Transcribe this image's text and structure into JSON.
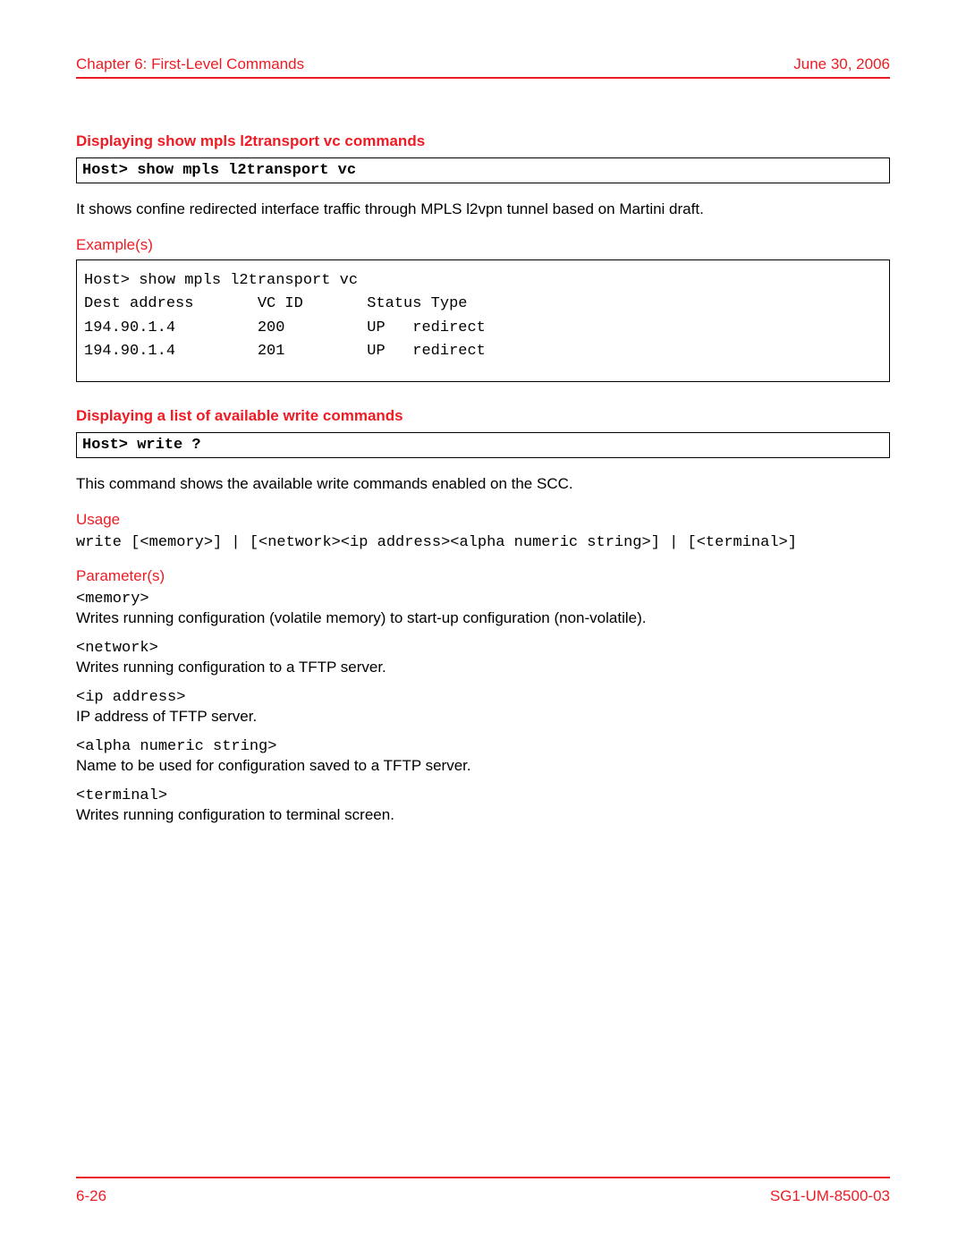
{
  "header": {
    "chapter": "Chapter 6: First-Level Commands",
    "date": "June 30, 2006"
  },
  "section1": {
    "title": "Displaying show mpls l2transport vc commands",
    "command": "Host> show mpls l2transport vc",
    "description": "It shows confine redirected interface traffic through MPLS l2vpn tunnel based on Martini draft.",
    "examples_label": "Example(s)",
    "example_text": "Host> show mpls l2transport vc\nDest address       VC ID       Status Type\n194.90.1.4         200         UP   redirect\n194.90.1.4         201         UP   redirect"
  },
  "section2": {
    "title": "Displaying a list of available write commands",
    "command": "Host> write ?",
    "description": "This command shows the available write commands enabled on the SCC.",
    "usage_label": "Usage",
    "usage_text": "write [<memory>] | [<network><ip address><alpha numeric string>] | [<terminal>]",
    "params_label": "Parameter(s)",
    "params": [
      {
        "name": "<memory>",
        "desc": "Writes running configuration (volatile memory) to start-up configuration (non-volatile)."
      },
      {
        "name": "<network>",
        "desc": "Writes running configuration to a TFTP server."
      },
      {
        "name": "<ip address>",
        "desc": "IP address of TFTP server."
      },
      {
        "name": "<alpha numeric string>",
        "desc": "Name to be used for configuration saved to a TFTP server."
      },
      {
        "name": "<terminal>",
        "desc": "Writes running configuration to terminal screen."
      }
    ]
  },
  "footer": {
    "page": "6-26",
    "docid": "SG1-UM-8500-03"
  }
}
